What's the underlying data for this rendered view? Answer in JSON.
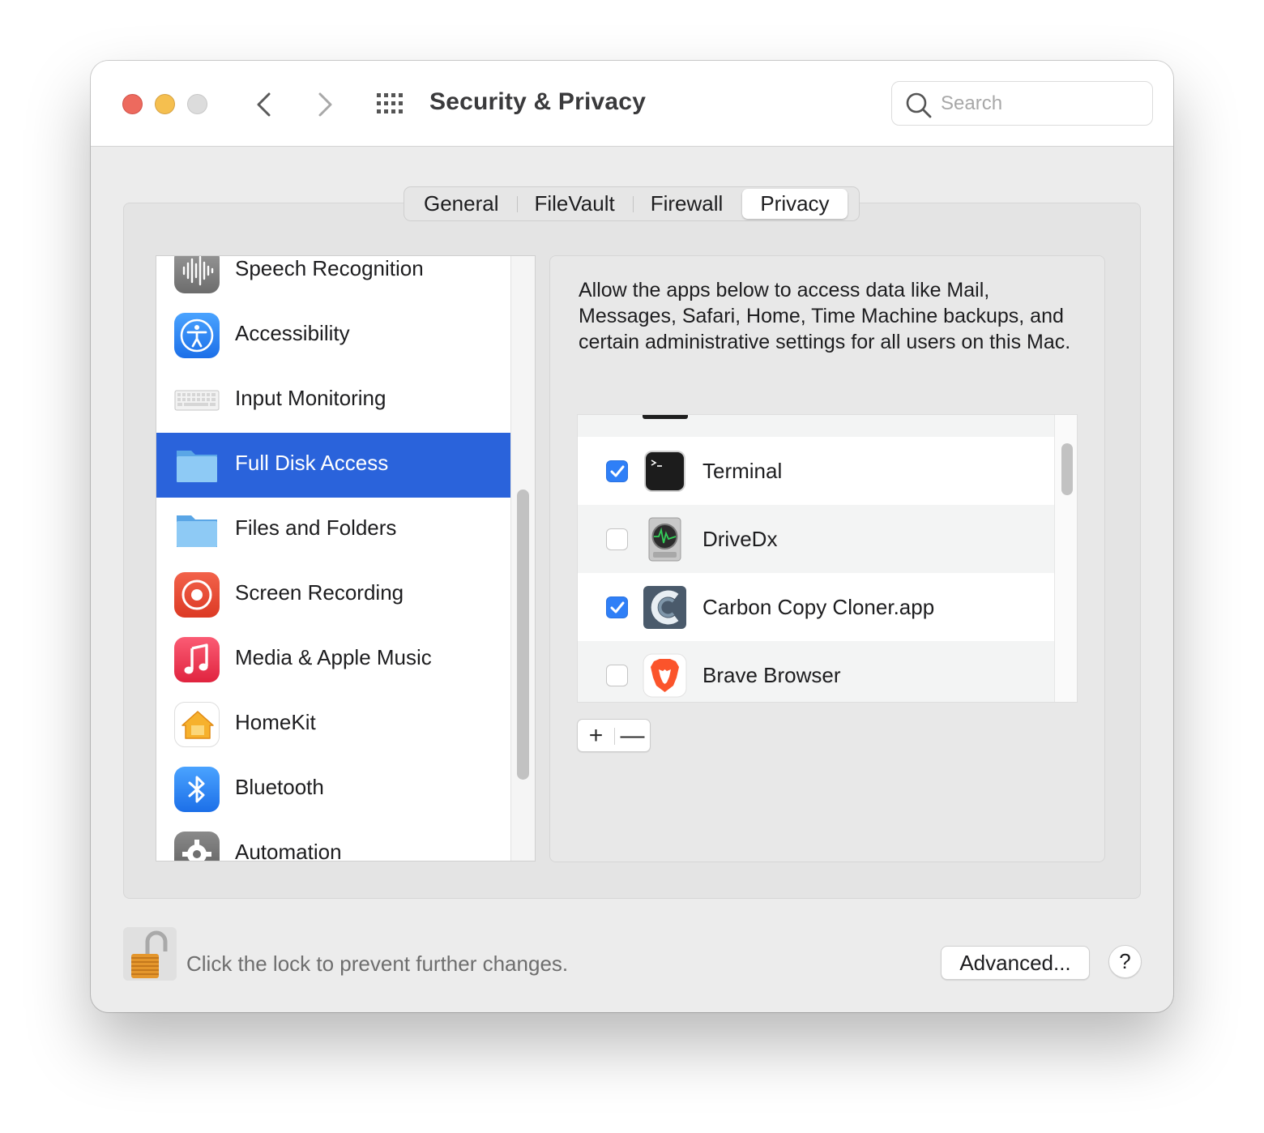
{
  "window": {
    "title": "Security & Privacy"
  },
  "search": {
    "placeholder": "Search",
    "value": ""
  },
  "tabs": [
    {
      "label": "General",
      "active": false
    },
    {
      "label": "FileVault",
      "active": false
    },
    {
      "label": "Firewall",
      "active": false
    },
    {
      "label": "Privacy",
      "active": true
    }
  ],
  "sidebar": {
    "items": [
      {
        "label": "Speech Recognition",
        "icon": "waveform-icon",
        "selected": false
      },
      {
        "label": "Accessibility",
        "icon": "accessibility-icon",
        "selected": false
      },
      {
        "label": "Input Monitoring",
        "icon": "keyboard-icon",
        "selected": false
      },
      {
        "label": "Full Disk Access",
        "icon": "folder-icon",
        "selected": true
      },
      {
        "label": "Files and Folders",
        "icon": "folder-icon",
        "selected": false
      },
      {
        "label": "Screen Recording",
        "icon": "record-icon",
        "selected": false
      },
      {
        "label": "Media & Apple Music",
        "icon": "music-note-icon",
        "selected": false
      },
      {
        "label": "HomeKit",
        "icon": "home-icon",
        "selected": false
      },
      {
        "label": "Bluetooth",
        "icon": "bluetooth-icon",
        "selected": false
      },
      {
        "label": "Automation",
        "icon": "gear-icon",
        "selected": false
      }
    ]
  },
  "detail": {
    "description": "Allow the apps below to access data like Mail, Messages, Safari, Home, Time Machine backups, and certain administrative settings for all users on this Mac.",
    "apps": [
      {
        "name": "Terminal",
        "checked": true,
        "icon": "terminal-icon"
      },
      {
        "name": "DriveDx",
        "checked": false,
        "icon": "drive-icon"
      },
      {
        "name": "Carbon Copy Cloner.app",
        "checked": true,
        "icon": "ccc-icon"
      },
      {
        "name": "Brave Browser",
        "checked": false,
        "icon": "brave-lion-icon"
      }
    ],
    "add_label": "+",
    "remove_label": "—"
  },
  "footer": {
    "lock_text": "Click the lock to prevent further changes.",
    "advanced_label": "Advanced...",
    "help_label": "?"
  },
  "colors": {
    "accent": "#2a63db",
    "checkbox": "#2f7ff7",
    "close": "#ed6a5e",
    "minimize": "#f5bf4f"
  }
}
